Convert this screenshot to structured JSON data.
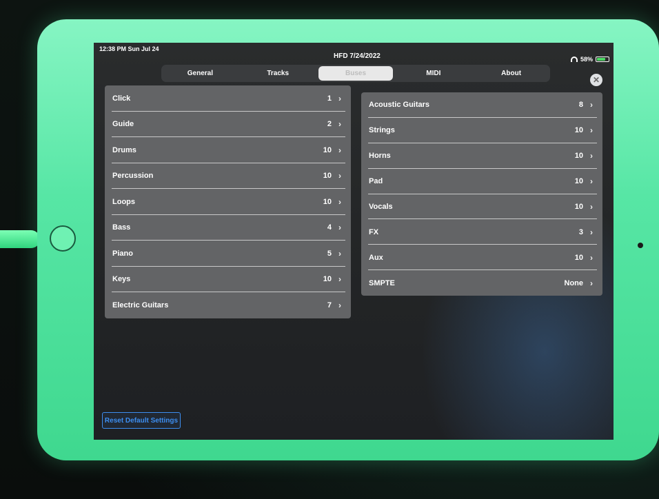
{
  "status_bar": {
    "time": "12:38 PM  Sun Jul 24",
    "title": "HFD 7/24/2022",
    "battery": "58%"
  },
  "tabs": [
    {
      "label": "General",
      "active": false
    },
    {
      "label": "Tracks",
      "active": false
    },
    {
      "label": "Buses",
      "active": true
    },
    {
      "label": "MIDI",
      "active": false
    },
    {
      "label": "About",
      "active": false
    }
  ],
  "close_label": "✕",
  "left_buses": [
    {
      "name": "Click",
      "value": "1"
    },
    {
      "name": "Guide",
      "value": "2"
    },
    {
      "name": "Drums",
      "value": "10"
    },
    {
      "name": "Percussion",
      "value": "10"
    },
    {
      "name": "Loops",
      "value": "10"
    },
    {
      "name": "Bass",
      "value": "4"
    },
    {
      "name": "Piano",
      "value": "5"
    },
    {
      "name": "Keys",
      "value": "10"
    },
    {
      "name": "Electric Guitars",
      "value": "7"
    }
  ],
  "right_buses": [
    {
      "name": "Acoustic Guitars",
      "value": "8"
    },
    {
      "name": "Strings",
      "value": "10"
    },
    {
      "name": "Horns",
      "value": "10"
    },
    {
      "name": "Pad",
      "value": "10"
    },
    {
      "name": "Vocals",
      "value": "10"
    },
    {
      "name": "FX",
      "value": "3"
    },
    {
      "name": "Aux",
      "value": "10"
    },
    {
      "name": "SMPTE",
      "value": "None"
    }
  ],
  "reset_label": "Reset Default Settings",
  "colors": {
    "accent": "#3d8ef0",
    "row_background": "#636466",
    "bezel": "#57e6a5"
  },
  "icons": {
    "chevron": "›"
  }
}
